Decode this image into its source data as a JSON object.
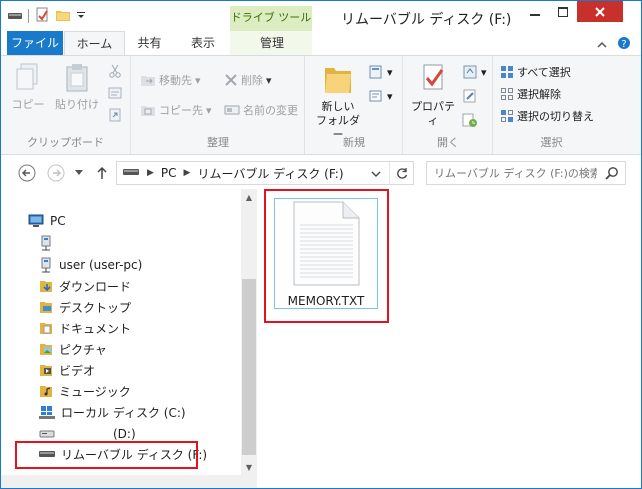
{
  "window": {
    "title": "リムーバブル ディスク (F:)",
    "context_tab_header": "ドライブ ツール"
  },
  "tabs": {
    "file": "ファイル",
    "home": "ホーム",
    "share": "共有",
    "view": "表示",
    "manage": "管理"
  },
  "ribbon": {
    "clipboard": {
      "copy": "コピー",
      "paste": "貼り付け",
      "group": "クリップボード"
    },
    "organize": {
      "move_to": "移動先",
      "copy_to": "コピー先",
      "delete": "削除",
      "rename": "名前の変更",
      "group": "整理"
    },
    "new": {
      "new_folder_line1": "新しい",
      "new_folder_line2": "フォルダー",
      "group": "新規"
    },
    "open": {
      "properties": "プロパティ",
      "group": "開く"
    },
    "select": {
      "select_all": "すべて選択",
      "select_none": "選択解除",
      "invert": "選択の切り替え",
      "group": "選択"
    }
  },
  "address": {
    "crumbs": [
      "PC",
      "リムーバブル ディスク (F:)"
    ]
  },
  "search": {
    "placeholder": "リムーバブル ディスク (F:)の検索"
  },
  "tree": {
    "pc": "PC",
    "network_drive": "",
    "user": "user (user-pc)",
    "downloads": "ダウンロード",
    "desktop": "デスクトップ",
    "documents": "ドキュメント",
    "pictures": "ピクチャ",
    "videos": "ビデオ",
    "music": "ミュージック",
    "local_disk": "ローカル ディスク (C:)",
    "d_drive": "(D:)",
    "removable": "リムーバブル ディスク (F:)"
  },
  "files": [
    {
      "name": "MEMORY.TXT"
    }
  ],
  "colors": {
    "accent": "#1979ca",
    "highlight": "#e0131f",
    "context_tab": "#dcedc1",
    "close": "#c7302b"
  }
}
